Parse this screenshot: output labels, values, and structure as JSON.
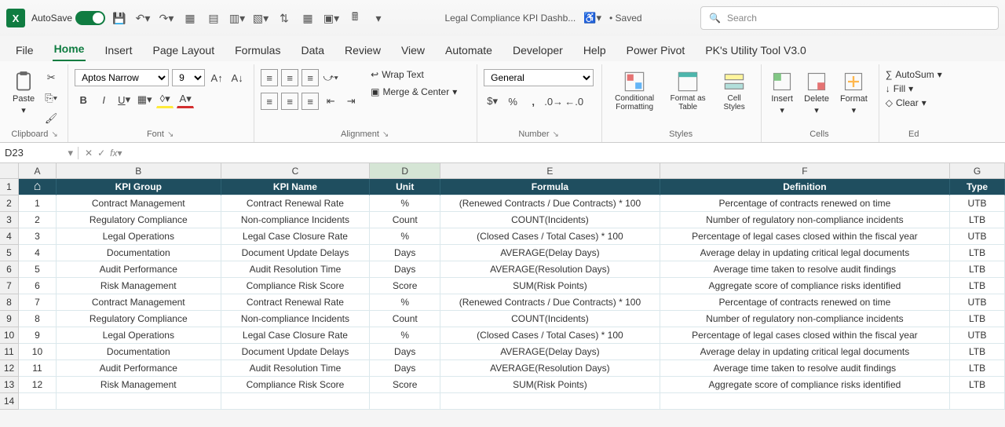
{
  "titlebar": {
    "autoSave": "AutoSave",
    "docTitle": "Legal Compliance KPI Dashb...",
    "savedStatus": "• Saved",
    "searchPlaceholder": "Search"
  },
  "ribbonTabs": [
    "File",
    "Home",
    "Insert",
    "Page Layout",
    "Formulas",
    "Data",
    "Review",
    "View",
    "Automate",
    "Developer",
    "Help",
    "Power Pivot",
    "PK's Utility Tool V3.0"
  ],
  "activeTab": "Home",
  "ribbon": {
    "clipboard": {
      "paste": "Paste",
      "label": "Clipboard"
    },
    "font": {
      "name": "Aptos Narrow",
      "size": "9",
      "label": "Font"
    },
    "alignment": {
      "wrap": "Wrap Text",
      "merge": "Merge & Center",
      "label": "Alignment"
    },
    "number": {
      "format": "General",
      "label": "Number"
    },
    "styles": {
      "cond": "Conditional Formatting",
      "fat": "Format as Table",
      "cs": "Cell Styles",
      "label": "Styles"
    },
    "cells": {
      "ins": "Insert",
      "del": "Delete",
      "fmt": "Format",
      "label": "Cells"
    },
    "editing": {
      "sum": "AutoSum",
      "fill": "Fill",
      "clear": "Clear",
      "label": "Ed"
    }
  },
  "nameBox": "D23",
  "columns": [
    "A",
    "B",
    "C",
    "D",
    "E",
    "F",
    "G"
  ],
  "headerRow": {
    "A": "#",
    "B": "KPI Group",
    "C": "KPI Name",
    "D": "Unit",
    "E": "Formula",
    "F": "Definition",
    "G": "Type",
    "homeIcon": "⌂"
  },
  "rows": [
    {
      "n": "1",
      "A": "1",
      "B": "Contract Management",
      "C": "Contract Renewal Rate",
      "D": "%",
      "E": "(Renewed Contracts / Due Contracts) * 100",
      "F": "Percentage of contracts renewed on time",
      "G": "UTB"
    },
    {
      "n": "2",
      "A": "2",
      "B": "Regulatory Compliance",
      "C": "Non-compliance Incidents",
      "D": "Count",
      "E": "COUNT(Incidents)",
      "F": "Number of regulatory non-compliance incidents",
      "G": "LTB"
    },
    {
      "n": "3",
      "A": "3",
      "B": "Legal Operations",
      "C": "Legal Case Closure Rate",
      "D": "%",
      "E": "(Closed Cases / Total Cases) * 100",
      "F": "Percentage of legal cases closed within the fiscal year",
      "G": "UTB"
    },
    {
      "n": "4",
      "A": "4",
      "B": "Documentation",
      "C": "Document Update Delays",
      "D": "Days",
      "E": "AVERAGE(Delay Days)",
      "F": "Average delay in updating critical legal documents",
      "G": "LTB"
    },
    {
      "n": "5",
      "A": "5",
      "B": "Audit Performance",
      "C": "Audit Resolution Time",
      "D": "Days",
      "E": "AVERAGE(Resolution Days)",
      "F": "Average time taken to resolve audit findings",
      "G": "LTB"
    },
    {
      "n": "6",
      "A": "6",
      "B": "Risk Management",
      "C": "Compliance Risk Score",
      "D": "Score",
      "E": "SUM(Risk Points)",
      "F": "Aggregate score of compliance risks identified",
      "G": "LTB"
    },
    {
      "n": "7",
      "A": "7",
      "B": "Contract Management",
      "C": "Contract Renewal Rate",
      "D": "%",
      "E": "(Renewed Contracts / Due Contracts) * 100",
      "F": "Percentage of contracts renewed on time",
      "G": "UTB"
    },
    {
      "n": "8",
      "A": "8",
      "B": "Regulatory Compliance",
      "C": "Non-compliance Incidents",
      "D": "Count",
      "E": "COUNT(Incidents)",
      "F": "Number of regulatory non-compliance incidents",
      "G": "LTB"
    },
    {
      "n": "9",
      "A": "9",
      "B": "Legal Operations",
      "C": "Legal Case Closure Rate",
      "D": "%",
      "E": "(Closed Cases / Total Cases) * 100",
      "F": "Percentage of legal cases closed within the fiscal year",
      "G": "UTB"
    },
    {
      "n": "10",
      "A": "10",
      "B": "Documentation",
      "C": "Document Update Delays",
      "D": "Days",
      "E": "AVERAGE(Delay Days)",
      "F": "Average delay in updating critical legal documents",
      "G": "LTB"
    },
    {
      "n": "11",
      "A": "11",
      "B": "Audit Performance",
      "C": "Audit Resolution Time",
      "D": "Days",
      "E": "AVERAGE(Resolution Days)",
      "F": "Average time taken to resolve audit findings",
      "G": "LTB"
    },
    {
      "n": "12",
      "A": "12",
      "B": "Risk Management",
      "C": "Compliance Risk Score",
      "D": "Score",
      "E": "SUM(Risk Points)",
      "F": "Aggregate score of compliance risks identified",
      "G": "LTB"
    }
  ]
}
